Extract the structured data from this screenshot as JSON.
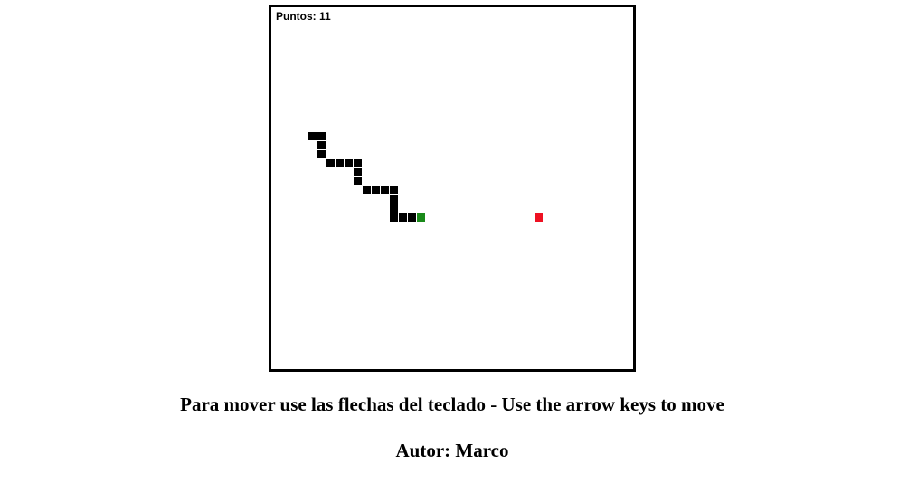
{
  "game": {
    "score_label": "Puntos: 11",
    "score": 11,
    "grid_cell_size": 10,
    "grid_size": [
      40,
      40
    ],
    "snake_color": "#000000",
    "head_color": "#1a8a1a",
    "food_color": "#ee1122",
    "snake_body": [
      [
        4,
        14
      ],
      [
        5,
        14
      ],
      [
        5,
        15
      ],
      [
        5,
        16
      ],
      [
        6,
        17
      ],
      [
        7,
        17
      ],
      [
        8,
        17
      ],
      [
        9,
        17
      ],
      [
        9,
        18
      ],
      [
        9,
        19
      ],
      [
        10,
        20
      ],
      [
        11,
        20
      ],
      [
        12,
        20
      ],
      [
        13,
        20
      ],
      [
        13,
        21
      ],
      [
        13,
        22
      ],
      [
        13,
        23
      ],
      [
        14,
        23
      ],
      [
        15,
        23
      ]
    ],
    "snake_head": [
      16,
      23
    ],
    "food": [
      29,
      23
    ]
  },
  "footer": {
    "instructions": "Para mover use las flechas del teclado - Use the arrow keys to move",
    "author": "Autor: Marco"
  }
}
